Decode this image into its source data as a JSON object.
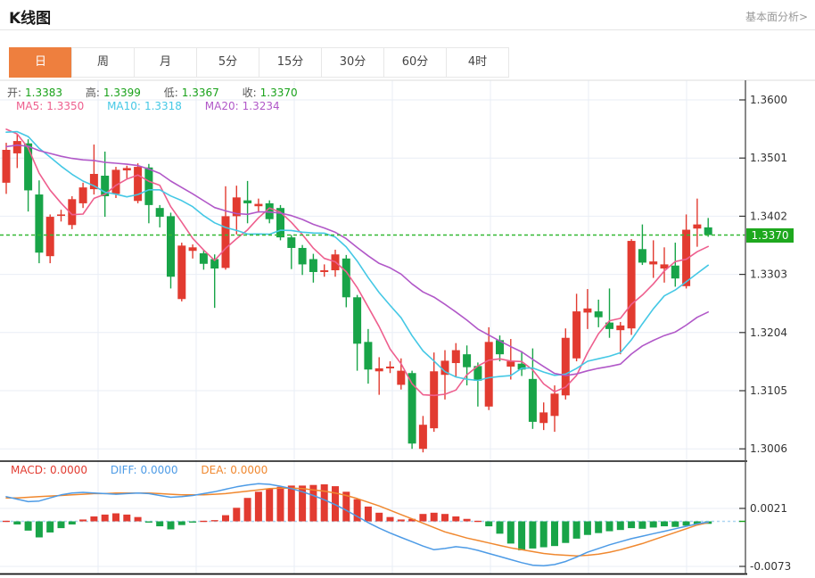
{
  "header": {
    "title": "K线图",
    "link_label": "基本面分析>"
  },
  "tabs": {
    "items": [
      {
        "label": "日",
        "active": true
      },
      {
        "label": "周",
        "active": false
      },
      {
        "label": "月",
        "active": false
      },
      {
        "label": "5分",
        "active": false
      },
      {
        "label": "15分",
        "active": false
      },
      {
        "label": "30分",
        "active": false
      },
      {
        "label": "60分",
        "active": false
      },
      {
        "label": "4时",
        "active": false
      }
    ]
  },
  "legend": {
    "ohlc": {
      "open_label": "开:",
      "open": "1.3383",
      "high_label": "高:",
      "high": "1.3399",
      "low_label": "低:",
      "low": "1.3367",
      "close_label": "收:",
      "close": "1.3370"
    },
    "ma": {
      "ma5_label": "MA5:",
      "ma5": "1.3350",
      "ma10_label": "MA10:",
      "ma10": "1.3318",
      "ma20_label": "MA20:",
      "ma20": "1.3234"
    },
    "macd": {
      "macd_label": "MACD:",
      "macd": "0.0000",
      "diff_label": "DIFF:",
      "diff": "0.0000",
      "dea_label": "DEA:",
      "dea": "0.0000"
    }
  },
  "price_tag": {
    "value": "1.3370"
  },
  "colors": {
    "up": "#e23b30",
    "down": "#18a448",
    "legend_green": "#1aa21a",
    "ma5": "#ee5f8e",
    "ma10": "#45c8e5",
    "ma20": "#b158c8",
    "diff": "#4d9be6",
    "dea": "#f0882f",
    "tab_active": "#ee7f3e",
    "price_tag_bg": "#1ea81e",
    "dotted_line": "#33b833",
    "grid": "#e9eef6",
    "axis_text": "#333333",
    "macd_zero": "#aed6f1"
  },
  "chart_data": {
    "type": "candlestick+macd",
    "title": "K线图",
    "legend_entries": [
      "MA5",
      "MA10",
      "MA20",
      "MACD",
      "DIFF",
      "DEA"
    ],
    "price_axis": {
      "ticks": [
        1.36,
        1.3501,
        1.3402,
        1.3303,
        1.3204,
        1.3105,
        1.3006
      ],
      "current_price": 1.337,
      "ylim": [
        1.2995,
        1.3625
      ],
      "grid": true
    },
    "macd_axis": {
      "ticks": [
        0.0021,
        -0.0073
      ]
    },
    "candles_ohlc": [
      [
        1.3459,
        1.3527,
        1.344,
        1.3515
      ],
      [
        1.3509,
        1.3542,
        1.3484,
        1.353
      ],
      [
        1.3526,
        1.3533,
        1.341,
        1.3446
      ],
      [
        1.3439,
        1.3463,
        1.3322,
        1.334
      ],
      [
        1.3334,
        1.3405,
        1.3322,
        1.3401
      ],
      [
        1.3403,
        1.3413,
        1.3393,
        1.3405
      ],
      [
        1.3387,
        1.3436,
        1.338,
        1.3431
      ],
      [
        1.3424,
        1.3459,
        1.3416,
        1.3451
      ],
      [
        1.3448,
        1.3524,
        1.3439,
        1.3474
      ],
      [
        1.3471,
        1.3512,
        1.3401,
        1.3436
      ],
      [
        1.344,
        1.3486,
        1.3433,
        1.3481
      ],
      [
        1.348,
        1.3488,
        1.3466,
        1.3484
      ],
      [
        1.3428,
        1.3492,
        1.3424,
        1.3486
      ],
      [
        1.3485,
        1.3491,
        1.339,
        1.3421
      ],
      [
        1.3416,
        1.3421,
        1.3383,
        1.3401
      ],
      [
        1.3402,
        1.3408,
        1.3279,
        1.3299
      ],
      [
        1.3261,
        1.3357,
        1.3257,
        1.3352
      ],
      [
        1.3343,
        1.3354,
        1.333,
        1.3349
      ],
      [
        1.3339,
        1.3345,
        1.3311,
        1.3321
      ],
      [
        1.3329,
        1.3337,
        1.3246,
        1.3313
      ],
      [
        1.3314,
        1.3453,
        1.3311,
        1.3402
      ],
      [
        1.3402,
        1.3454,
        1.3371,
        1.3434
      ],
      [
        1.3429,
        1.3462,
        1.339,
        1.3424
      ],
      [
        1.3419,
        1.3432,
        1.3408,
        1.3423
      ],
      [
        1.3424,
        1.3429,
        1.339,
        1.3397
      ],
      [
        1.3416,
        1.3421,
        1.3361,
        1.3366
      ],
      [
        1.3366,
        1.337,
        1.3312,
        1.3348
      ],
      [
        1.3348,
        1.3353,
        1.3302,
        1.332
      ],
      [
        1.3329,
        1.3338,
        1.3289,
        1.3307
      ],
      [
        1.3307,
        1.332,
        1.3299,
        1.331
      ],
      [
        1.331,
        1.3345,
        1.3299,
        1.3337
      ],
      [
        1.333,
        1.3336,
        1.3247,
        1.3264
      ],
      [
        1.3264,
        1.3268,
        1.3139,
        1.3185
      ],
      [
        1.3188,
        1.321,
        1.3117,
        1.3141
      ],
      [
        1.3138,
        1.3162,
        1.3098,
        1.3143
      ],
      [
        1.3143,
        1.3155,
        1.3135,
        1.3146
      ],
      [
        1.3115,
        1.316,
        1.3107,
        1.3139
      ],
      [
        1.3135,
        1.3139,
        1.3006,
        1.3015
      ],
      [
        1.3006,
        1.3062,
        1.3,
        1.3047
      ],
      [
        1.3041,
        1.317,
        1.3035,
        1.3138
      ],
      [
        1.3132,
        1.3174,
        1.309,
        1.3156
      ],
      [
        1.3152,
        1.3186,
        1.3129,
        1.3174
      ],
      [
        1.3167,
        1.3182,
        1.3114,
        1.3145
      ],
      [
        1.3147,
        1.3153,
        1.3078,
        1.3122
      ],
      [
        1.3078,
        1.3213,
        1.3072,
        1.3188
      ],
      [
        1.3191,
        1.3199,
        1.3155,
        1.3167
      ],
      [
        1.3146,
        1.3193,
        1.3124,
        1.3155
      ],
      [
        1.3151,
        1.3172,
        1.313,
        1.3141
      ],
      [
        1.3125,
        1.3177,
        1.304,
        1.3052
      ],
      [
        1.305,
        1.3085,
        1.3038,
        1.3068
      ],
      [
        1.3062,
        1.3114,
        1.3035,
        1.31
      ],
      [
        1.3097,
        1.3211,
        1.309,
        1.3195
      ],
      [
        1.316,
        1.327,
        1.3155,
        1.324
      ],
      [
        1.3238,
        1.3278,
        1.321,
        1.3245
      ],
      [
        1.324,
        1.326,
        1.3213,
        1.323
      ],
      [
        1.3221,
        1.3279,
        1.3195,
        1.321
      ],
      [
        1.3208,
        1.3222,
        1.3167,
        1.3216
      ],
      [
        1.3211,
        1.3363,
        1.32,
        1.336
      ],
      [
        1.3346,
        1.3388,
        1.3319,
        1.3323
      ],
      [
        1.332,
        1.3361,
        1.3297,
        1.3325
      ],
      [
        1.3313,
        1.3349,
        1.3289,
        1.332
      ],
      [
        1.3318,
        1.3357,
        1.3282,
        1.3296
      ],
      [
        1.3283,
        1.3405,
        1.3279,
        1.3379
      ],
      [
        1.3381,
        1.3432,
        1.335,
        1.3388
      ],
      [
        1.3383,
        1.3399,
        1.3367,
        1.337
      ]
    ],
    "ma_periods": [
      5,
      10,
      20
    ],
    "ma_seed_closes": [
      1.348,
      1.3485,
      1.349,
      1.3495,
      1.35,
      1.3505,
      1.35,
      1.3495,
      1.35,
      1.351,
      1.352,
      1.353,
      1.354,
      1.355,
      1.356,
      1.357,
      1.3565,
      1.3555,
      1.3545
    ],
    "macd": {
      "unit": 0.0001,
      "histogram": [
        1,
        -5,
        -15,
        -26,
        -18,
        -11,
        -5,
        3,
        8,
        11,
        13,
        11,
        7,
        -2,
        -8,
        -13,
        -6,
        -2,
        1,
        2,
        10,
        22,
        38,
        48,
        53,
        56,
        58,
        58,
        59,
        60,
        57,
        48,
        36,
        24,
        14,
        7,
        3,
        4,
        12,
        14,
        12,
        8,
        4,
        1,
        -8,
        -20,
        -36,
        -47,
        -44,
        -42,
        -40,
        -35,
        -28,
        -22,
        -19,
        -16,
        -14,
        -11,
        -12,
        -10,
        -8,
        -9,
        -7,
        -5,
        -4
      ],
      "diff": [
        40,
        36,
        32,
        33,
        38,
        43,
        46,
        47,
        46,
        45,
        44,
        45,
        46,
        45,
        42,
        39,
        40,
        42,
        45,
        48,
        52,
        56,
        59,
        61,
        60,
        57,
        53,
        48,
        42,
        35,
        27,
        18,
        8,
        -2,
        -11,
        -19,
        -26,
        -33,
        -40,
        -46,
        -44,
        -41,
        -43,
        -47,
        -52,
        -57,
        -62,
        -67,
        -71,
        -72,
        -70,
        -65,
        -58,
        -50,
        -44,
        -38,
        -33,
        -28,
        -24,
        -20,
        -16,
        -12,
        -8,
        -4,
        -1
      ],
      "dea": [
        38,
        38,
        39,
        40,
        41,
        42,
        43,
        44,
        45,
        45,
        46,
        46,
        46,
        46,
        45,
        44,
        43,
        43,
        43,
        44,
        45,
        47,
        49,
        51,
        53,
        54,
        54,
        53,
        51,
        49,
        46,
        42,
        37,
        31,
        25,
        18,
        11,
        4,
        -3,
        -10,
        -17,
        -22,
        -27,
        -31,
        -35,
        -39,
        -43,
        -46,
        -49,
        -52,
        -54,
        -55,
        -56,
        -55,
        -53,
        -50,
        -46,
        -41,
        -36,
        -30,
        -24,
        -18,
        -12,
        -6,
        -2
      ]
    }
  }
}
